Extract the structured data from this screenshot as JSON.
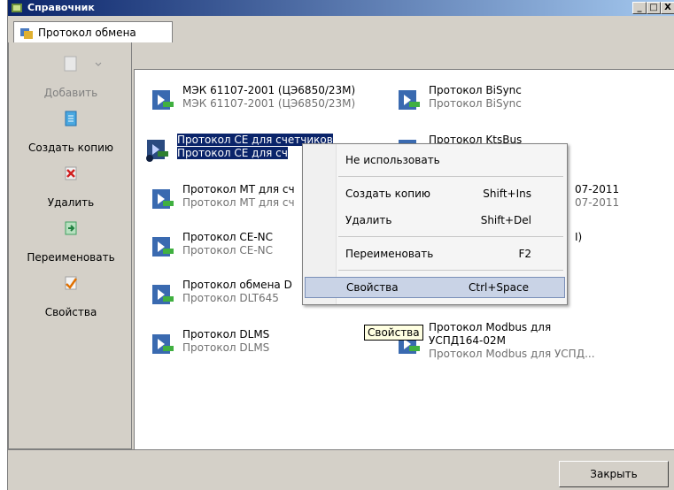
{
  "window": {
    "title": "Справочник",
    "min_glyph": "_",
    "max_glyph": "□",
    "close_glyph": "X"
  },
  "tab": {
    "label": "Протокол обмена"
  },
  "toolbar": {
    "add": "Добавить",
    "copy": "Создать копию",
    "delete": "Удалить",
    "rename": "Переименовать",
    "properties": "Свойства"
  },
  "items": [
    {
      "t1": "МЭК 61107-2001 (ЦЭ6850/23М)",
      "t2": "МЭК 61107-2001 (ЦЭ6850/23М)"
    },
    {
      "t1": "Протокол BiSync",
      "t2": "Протокол BiSync"
    },
    {
      "t1": "Протокол CE для счетчиков",
      "t2": "Протокол CE для сч"
    },
    {
      "t1": "Протокол KtsBus",
      "t2": ""
    },
    {
      "t1": "Протокол MT для сч",
      "t2": "Протокол MT для сч"
    },
    {
      "t1": "07-2011",
      "t2": "07-2011"
    },
    {
      "t1": "Протокол CE-NC",
      "t2": "Протокол CE-NC"
    },
    {
      "t1": "I)",
      "t2": ""
    },
    {
      "t1": "Протокол обмена D",
      "t2": "Протокол DLT645"
    },
    {
      "t1": "Протокол DLMS",
      "t2": "Протокол DLMS"
    },
    {
      "t1": "Протокол Modbus для",
      "t1b": "УСПД164-02М",
      "t2": "Протокол Modbus для УСПД..."
    }
  ],
  "menu": {
    "not_use": "Не использовать",
    "copy": "Создать копию",
    "copy_sc": "Shift+Ins",
    "delete": "Удалить",
    "delete_sc": "Shift+Del",
    "rename": "Переименовать",
    "rename_sc": "F2",
    "props": "Свойства",
    "props_sc": "Ctrl+Space"
  },
  "tooltip": "Свойства",
  "close_button": "Закрыть",
  "colors": {
    "titlebar": "#0a246a",
    "selection": "#0a246a",
    "menu_hover": "#c9d3e6"
  }
}
